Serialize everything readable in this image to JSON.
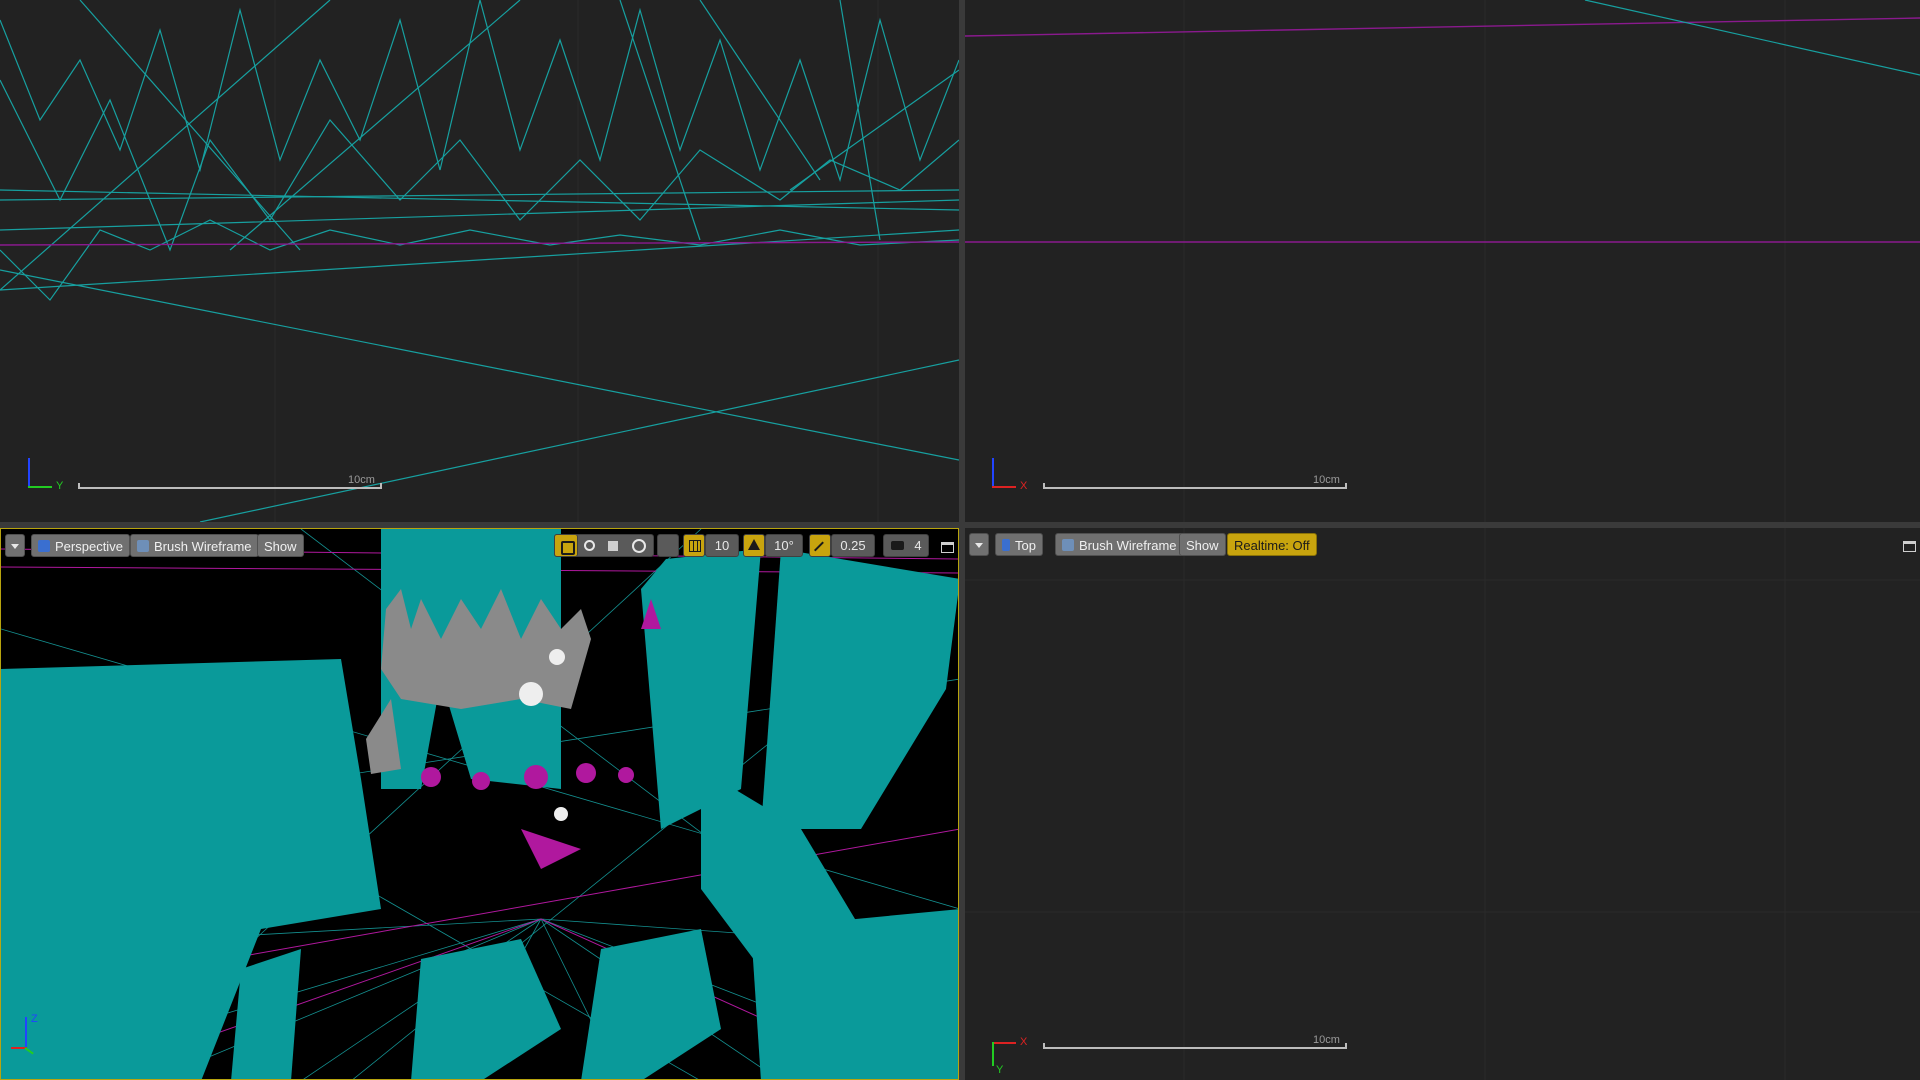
{
  "colors": {
    "viewport_bg": "#222222",
    "wire_cyan": "#1a9e9e",
    "wire_magenta": "#a0159c",
    "mesh_teal": "#0a9696",
    "accent_yellow": "#c8a40e"
  },
  "viewports": {
    "top_left": {
      "scale_label": "10cm",
      "axis_labels": [
        "Y"
      ]
    },
    "top_right": {
      "scale_label": "10cm",
      "axis_labels": [
        "X"
      ]
    },
    "bottom_left": {
      "toolbar": {
        "menu_icon": "dropdown-arrow-icon",
        "view_mode": "Perspective",
        "view_icon": "perspective-icon",
        "render_mode": "Brush Wireframe",
        "show": "Show",
        "grid_snap": "10",
        "rotation_snap": "10°",
        "scale_snap": "0.25",
        "camera_speed": "4"
      },
      "axis_labels": [
        "Z"
      ]
    },
    "bottom_right": {
      "toolbar": {
        "menu_icon": "dropdown-arrow-icon",
        "view_mode": "Top",
        "view_icon": "top-view-icon",
        "render_mode": "Brush Wireframe",
        "show": "Show",
        "realtime": "Realtime: Off"
      },
      "scale_label": "10cm",
      "axis_labels": [
        "X",
        "Y"
      ]
    }
  }
}
